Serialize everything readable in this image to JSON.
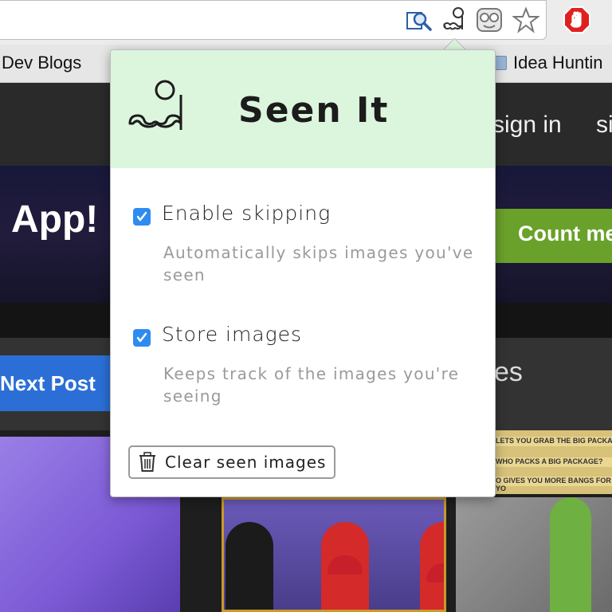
{
  "bookmarks": {
    "left_label": "Dev Blogs",
    "right_label": "Idea Huntin"
  },
  "page": {
    "nav_signin": "sign in",
    "nav_signup": "si",
    "hero_title": "App!",
    "hero_button": "Count me",
    "next_post": "Next Post",
    "section_fragment": "es",
    "news_lines": [
      "LETS YOU GRAB THE BIG PACKAG",
      "WHO PACKS A BIG PACKAGE?",
      "O GIVES YOU MORE BANGS   FOR YO"
    ]
  },
  "toolbar_icons": {
    "search": "search-page-icon",
    "seen_it": "monocle-mustache-icon",
    "face": "face-icon",
    "star": "star-icon",
    "adblock": "adblock-stop-icon"
  },
  "popup": {
    "title": "Seen It",
    "options": [
      {
        "label": "Enable skipping",
        "description": "Automatically skips images you've seen",
        "checked": true
      },
      {
        "label": "Store images",
        "description": "Keeps track of the images you're seeing",
        "checked": true
      }
    ],
    "clear_button": "Clear seen images"
  },
  "colors": {
    "header_bg": "#dcf6de",
    "checkbox": "#2e8cf0",
    "hero_button": "#6aa12a",
    "next_post_button": "#2b6fd6"
  }
}
